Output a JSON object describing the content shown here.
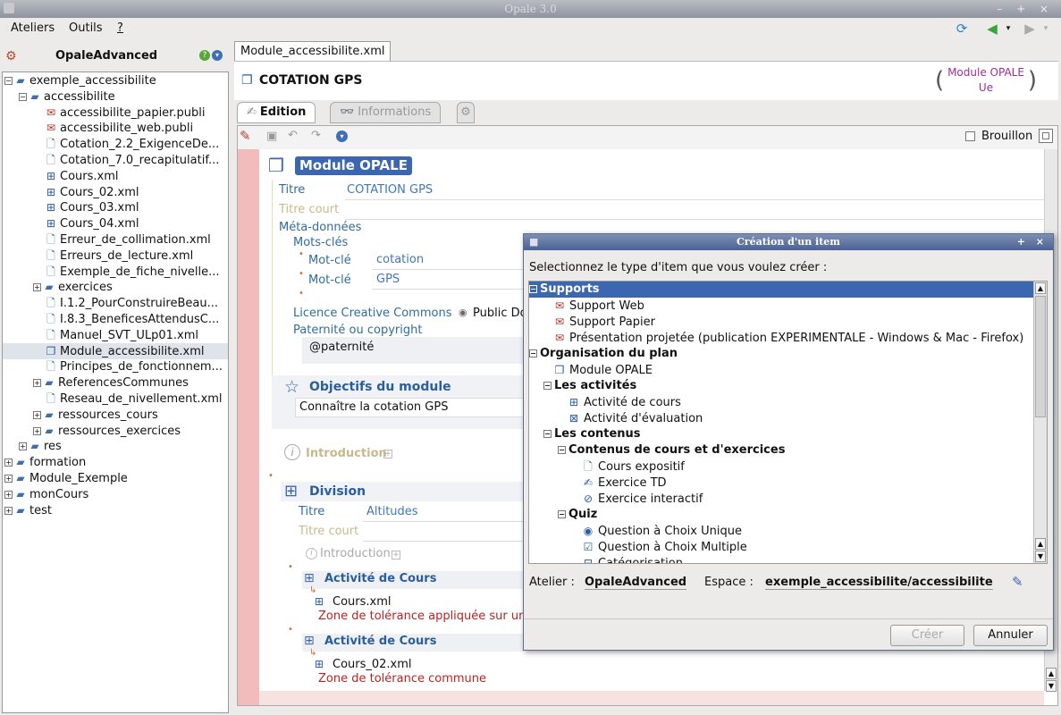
{
  "window": {
    "title": "Opale 3.0"
  },
  "menu": {
    "items": [
      "Ateliers",
      "Outils",
      "?"
    ]
  },
  "left_panel": {
    "title": "OpaleAdvanced",
    "tree": [
      {
        "label": "exemple_accessibilite",
        "depth": 0,
        "kind": "folder",
        "expanded": true
      },
      {
        "label": "accessibilite",
        "depth": 1,
        "kind": "folder",
        "expanded": true
      },
      {
        "label": "accessibilite_papier.publi",
        "depth": 2,
        "kind": "publi"
      },
      {
        "label": "accessibilite_web.publi",
        "depth": 2,
        "kind": "publi"
      },
      {
        "label": "Cotation_2.2_ExigenceDe...",
        "depth": 2,
        "kind": "file"
      },
      {
        "label": "Cotation_7.0_recapitulatif...",
        "depth": 2,
        "kind": "file"
      },
      {
        "label": "Cours.xml",
        "depth": 2,
        "kind": "course"
      },
      {
        "label": "Cours_02.xml",
        "depth": 2,
        "kind": "course"
      },
      {
        "label": "Cours_03.xml",
        "depth": 2,
        "kind": "course"
      },
      {
        "label": "Cours_04.xml",
        "depth": 2,
        "kind": "course"
      },
      {
        "label": "Erreur_de_collimation.xml",
        "depth": 2,
        "kind": "file"
      },
      {
        "label": "Erreurs_de_lecture.xml",
        "depth": 2,
        "kind": "file"
      },
      {
        "label": "Exemple_de_fiche_nivelle...",
        "depth": 2,
        "kind": "file"
      },
      {
        "label": "exercices",
        "depth": 2,
        "kind": "folder",
        "expanded": false
      },
      {
        "label": "I.1.2_PourConstruireBeau...",
        "depth": 2,
        "kind": "file"
      },
      {
        "label": "I.8.3_BeneficesAttendusC...",
        "depth": 2,
        "kind": "file"
      },
      {
        "label": "Manuel_SVT_ULp01.xml",
        "depth": 2,
        "kind": "file"
      },
      {
        "label": "Module_accessibilite.xml",
        "depth": 2,
        "kind": "module",
        "selected": true
      },
      {
        "label": "Principes_de_fonctionnem...",
        "depth": 2,
        "kind": "file"
      },
      {
        "label": "ReferencesCommunes",
        "depth": 2,
        "kind": "folder",
        "expanded": false
      },
      {
        "label": "Reseau_de_nivellement.xml",
        "depth": 2,
        "kind": "file"
      },
      {
        "label": "ressources_cours",
        "depth": 2,
        "kind": "folder",
        "expanded": false
      },
      {
        "label": "ressources_exercices",
        "depth": 2,
        "kind": "folder",
        "expanded": false
      },
      {
        "label": "res",
        "depth": 1,
        "kind": "folder",
        "expanded": false
      },
      {
        "label": "formation",
        "depth": 0,
        "kind": "folder",
        "expanded": false
      },
      {
        "label": "Module_Exemple",
        "depth": 0,
        "kind": "folder",
        "expanded": false
      },
      {
        "label": "monCours",
        "depth": 0,
        "kind": "folder",
        "expanded": false
      },
      {
        "label": "test",
        "depth": 0,
        "kind": "folder",
        "expanded": false
      }
    ]
  },
  "document": {
    "tab_label": "Module_accessibilite.xml",
    "title": "COTATION GPS",
    "model_line1": "Module OPALE",
    "model_line2": "Ue",
    "subtabs": {
      "edition": "Edition",
      "informations": "Informations"
    },
    "brouillon_label": "Brouillon"
  },
  "editor": {
    "module_badge": "Module OPALE",
    "titre_label": "Titre",
    "titre_value": "COTATION GPS",
    "titre_court_label": "Titre court",
    "meta_label": "Méta-données",
    "mots_cles_label": "Mots-clés",
    "mot_cle_label": "Mot-clé",
    "mot_cle_1": "cotation",
    "mot_cle_2": "GPS",
    "licence_label": "Licence Creative Commons",
    "licence_value": "Public Do",
    "paternite_label": "Paternité ou copyright",
    "paternite_value": "@paternité",
    "objectifs_title": "Objectifs du module",
    "objectifs_value": "Connaître la cotation GPS",
    "introduction_label": "Introduction",
    "division_title": "Division",
    "division_titre_label": "Titre",
    "division_titre_value": "Altitudes",
    "division_titre_court_label": "Titre court",
    "division_intro_label": "Introduction",
    "activite_1_title": "Activité de Cours",
    "activite_1_file": "Cours.xml",
    "activite_1_note": "Zone de tolérance appliquée sur un",
    "activite_2_title": "Activité de Cours",
    "activite_2_file": "Cours_02.xml",
    "activite_2_note": "Zone de tolérance commune"
  },
  "dialog": {
    "title": "Création d'un item",
    "prompt": "Selectionnez le type d'item que vous voulez créer :",
    "items": {
      "supports": "Supports",
      "support_web": "Support Web",
      "support_papier": "Support Papier",
      "presentation": "Présentation projetée (publication EXPERIMENTALE - Windows & Mac - Firefox)",
      "organisation": "Organisation du plan",
      "module_opale": "Module OPALE",
      "activites": "Les activités",
      "activite_cours": "Activité de cours",
      "activite_eval": "Activité d'évaluation",
      "contenus": "Les contenus",
      "contenus_cours": "Contenus de cours et d'exercices",
      "cours_expositif": "Cours expositif",
      "exercice_td": "Exercice TD",
      "exercice_interactif": "Exercice interactif",
      "quiz": "Quiz",
      "qcu": "Question à Choix Unique",
      "qcm": "Question à Choix Multiple",
      "categorisation": "Catégorisation"
    },
    "atelier_label": "Atelier :",
    "atelier_value": "OpaleAdvanced",
    "espace_label": "Espace :",
    "espace_value": "exemple_accessibilite/accessibilite",
    "creer_label": "Créer",
    "annuler_label": "Annuler"
  }
}
